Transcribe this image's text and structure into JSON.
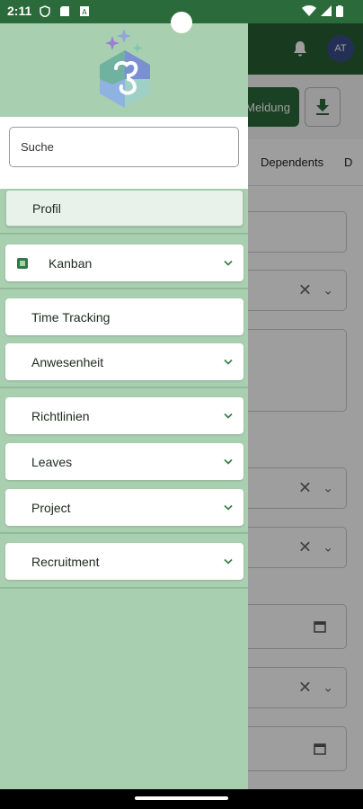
{
  "status_bar": {
    "time": "2:11"
  },
  "background": {
    "avatar_initials": "AT",
    "meldung_button": "Meldung",
    "tabs": [
      "Dependents",
      "D"
    ]
  },
  "drawer": {
    "search": {
      "placeholder": "Suche",
      "value": ""
    },
    "items": [
      {
        "label": "Profil",
        "active": true,
        "expandable": false
      },
      {
        "label": "Kanban",
        "expandable": true,
        "icon": "kanban-icon"
      },
      {
        "label": "Time Tracking",
        "expandable": false
      },
      {
        "label": "Anwesenheit",
        "expandable": true
      },
      {
        "label": "Richtlinien",
        "expandable": true
      },
      {
        "label": "Leaves",
        "expandable": true
      },
      {
        "label": "Project",
        "expandable": true
      },
      {
        "label": "Recruitment",
        "expandable": true
      }
    ]
  },
  "colors": {
    "primary_green": "#2b6a3a",
    "drawer_bg": "#a9cfb1",
    "active_item": "#e8f1ea"
  }
}
